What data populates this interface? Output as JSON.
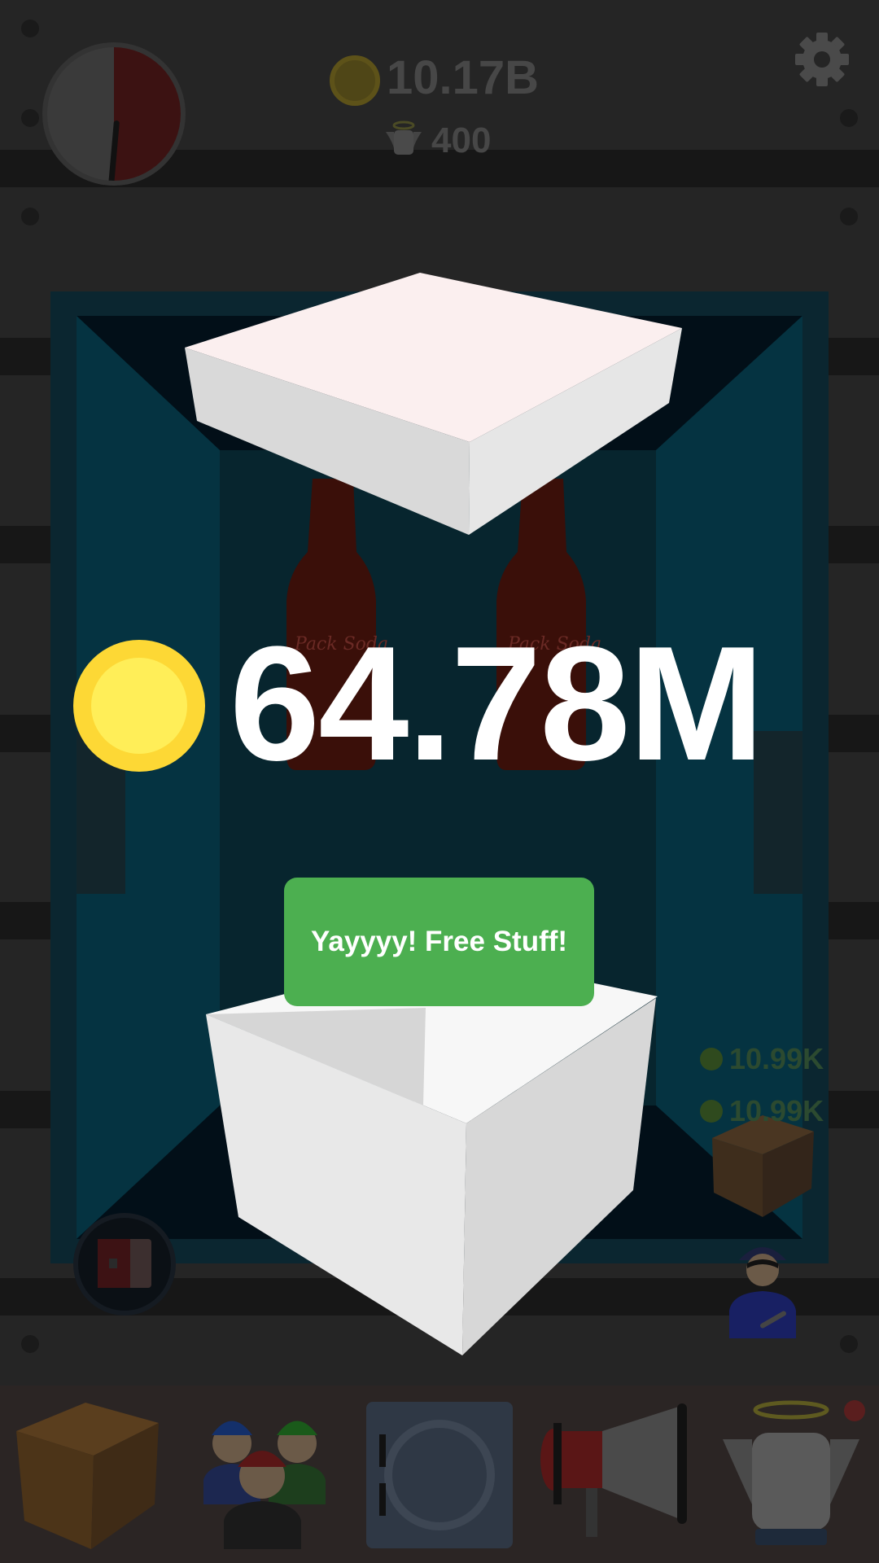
{
  "header": {
    "money": "10.17B",
    "angels": "400",
    "settings_icon": "gear-icon",
    "timer_icon": "dial-timer-icon"
  },
  "reward": {
    "amount": "64.78M",
    "button_label": "Yayyyy! Free Stuff!"
  },
  "machine": {
    "income_lines": [
      "10.99K",
      "10.99K"
    ],
    "bottle_label": "Pack Soda"
  },
  "bottom_nav": {
    "items": [
      {
        "name": "box-icon"
      },
      {
        "name": "workers-icon"
      },
      {
        "name": "vault-icon"
      },
      {
        "name": "megaphone-icon"
      },
      {
        "name": "angel-icon"
      }
    ]
  },
  "colors": {
    "accent_green": "#4caf50",
    "coin_yellow": "#fdd835",
    "machine_teal": "#0b2630"
  }
}
